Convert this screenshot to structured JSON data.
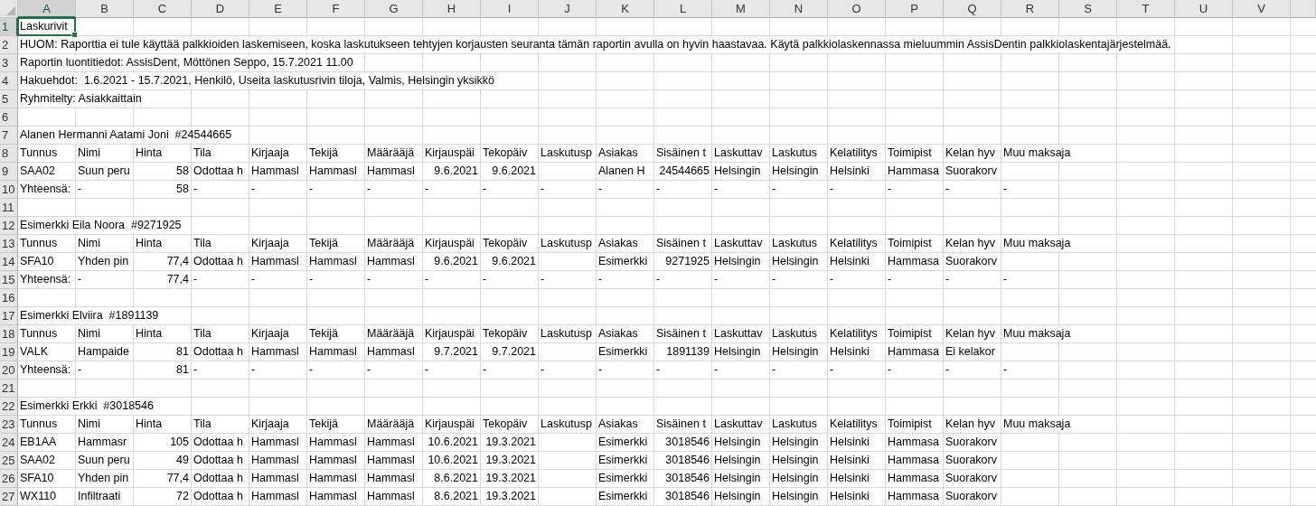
{
  "columns": [
    {
      "label": "A",
      "selected": true
    },
    {
      "label": "B",
      "selected": false
    },
    {
      "label": "C",
      "selected": false
    },
    {
      "label": "D",
      "selected": false
    },
    {
      "label": "E",
      "selected": false
    },
    {
      "label": "F",
      "selected": false
    },
    {
      "label": "G",
      "selected": false
    },
    {
      "label": "H",
      "selected": false
    },
    {
      "label": "I",
      "selected": false
    },
    {
      "label": "J",
      "selected": false
    },
    {
      "label": "K",
      "selected": false
    },
    {
      "label": "L",
      "selected": false
    },
    {
      "label": "M",
      "selected": false
    },
    {
      "label": "N",
      "selected": false
    },
    {
      "label": "O",
      "selected": false
    },
    {
      "label": "P",
      "selected": false
    },
    {
      "label": "Q",
      "selected": false
    },
    {
      "label": "R",
      "selected": false
    },
    {
      "label": "S",
      "selected": false
    },
    {
      "label": "T",
      "selected": false
    },
    {
      "label": "U",
      "selected": false
    },
    {
      "label": "V",
      "selected": false
    }
  ],
  "rows": [
    {
      "number": "1",
      "selected": true,
      "cells": [
        {
          "kind": "text",
          "text": "Laskurivit"
        }
      ]
    },
    {
      "number": "2",
      "selected": false,
      "cells": [
        {
          "kind": "text",
          "text": "HUOM: Raporttia ei tule käyttää palkkioiden laskemiseen, koska laskutukseen tehtyjen korjausten seuranta tämän raportin avulla on hyvin haastavaa. Käytä palkkiolaskennassa mieluummin AssisDentin palkkiolaskentajärjestelmää."
        }
      ]
    },
    {
      "number": "3",
      "selected": false,
      "cells": [
        {
          "kind": "text",
          "text": "Raportin luontitiedot: AssisDent, Möttönen Seppo, 15.7.2021 11.00"
        }
      ]
    },
    {
      "number": "4",
      "selected": false,
      "cells": [
        {
          "kind": "text",
          "text": "Hakuehdot:  1.6.2021 - 15.7.2021, Henkilö, Useita laskutusrivin tiloja, Valmis, Helsingin yksikkö"
        }
      ]
    },
    {
      "number": "5",
      "selected": false,
      "cells": [
        {
          "kind": "text",
          "text": "Ryhmitelty: Asiakkaittain"
        }
      ]
    },
    {
      "number": "6",
      "selected": false,
      "cells": []
    },
    {
      "number": "7",
      "selected": false,
      "cells": [
        {
          "kind": "text",
          "text": "Alanen Hermanni Aatami Joni  #24544665"
        }
      ]
    },
    {
      "number": "8",
      "selected": false,
      "cells": [
        {
          "kind": "text",
          "text": "Tunnus"
        },
        {
          "kind": "text",
          "text": "Nimi"
        },
        {
          "kind": "text",
          "text": "Hinta"
        },
        {
          "kind": "text",
          "text": "Tila"
        },
        {
          "kind": "text",
          "text": "Kirjaaja"
        },
        {
          "kind": "text",
          "text": "Tekijä"
        },
        {
          "kind": "text",
          "text": "Määrääjä"
        },
        {
          "kind": "text",
          "text": "Kirjauspäi"
        },
        {
          "kind": "text",
          "text": "Tekopäiv"
        },
        {
          "kind": "text",
          "text": "Laskutusp"
        },
        {
          "kind": "text",
          "text": "Asiakas"
        },
        {
          "kind": "text",
          "text": "Sisäinen t"
        },
        {
          "kind": "text",
          "text": "Laskuttav"
        },
        {
          "kind": "text",
          "text": "Laskutus"
        },
        {
          "kind": "text",
          "text": "Kelatilitys"
        },
        {
          "kind": "text",
          "text": "Toimipist"
        },
        {
          "kind": "text",
          "text": "Kelan hyv"
        },
        {
          "kind": "text",
          "text": "Muu maksaja"
        }
      ]
    },
    {
      "number": "9",
      "selected": false,
      "cells": [
        {
          "kind": "text",
          "text": "SAA02"
        },
        {
          "kind": "text",
          "text": "Suun peru"
        },
        {
          "kind": "number",
          "text": "58"
        },
        {
          "kind": "text",
          "text": "Odottaa h"
        },
        {
          "kind": "text",
          "text": "Hammasl"
        },
        {
          "kind": "text",
          "text": "Hammasl"
        },
        {
          "kind": "text",
          "text": "Hammasl"
        },
        {
          "kind": "number",
          "text": "9.6.2021"
        },
        {
          "kind": "number",
          "text": "9.6.2021"
        },
        null,
        {
          "kind": "text",
          "text": "Alanen H"
        },
        {
          "kind": "number",
          "text": "24544665"
        },
        {
          "kind": "text",
          "text": "Helsingin"
        },
        {
          "kind": "text",
          "text": "Helsingin"
        },
        {
          "kind": "text",
          "text": "Helsinki"
        },
        {
          "kind": "text",
          "text": "Hammasa"
        },
        {
          "kind": "text",
          "text": "Suorakorv"
        }
      ]
    },
    {
      "number": "10",
      "selected": false,
      "cells": [
        {
          "kind": "text",
          "text": "Yhteensä:"
        },
        {
          "kind": "text",
          "text": "-"
        },
        {
          "kind": "number",
          "text": "58"
        },
        {
          "kind": "text",
          "text": "-"
        },
        {
          "kind": "text",
          "text": "-"
        },
        {
          "kind": "text",
          "text": "-"
        },
        {
          "kind": "text",
          "text": "-"
        },
        {
          "kind": "text",
          "text": "-"
        },
        {
          "kind": "text",
          "text": "-"
        },
        {
          "kind": "text",
          "text": "-"
        },
        {
          "kind": "text",
          "text": "-"
        },
        {
          "kind": "text",
          "text": "-"
        },
        {
          "kind": "text",
          "text": "-"
        },
        {
          "kind": "text",
          "text": "-"
        },
        {
          "kind": "text",
          "text": "-"
        },
        {
          "kind": "text",
          "text": "-"
        },
        {
          "kind": "text",
          "text": "-"
        },
        {
          "kind": "text",
          "text": "-"
        }
      ]
    },
    {
      "number": "11",
      "selected": false,
      "cells": []
    },
    {
      "number": "12",
      "selected": false,
      "cells": [
        {
          "kind": "text",
          "text": "Esimerkki Eila Noora  #9271925"
        }
      ]
    },
    {
      "number": "13",
      "selected": false,
      "cells": [
        {
          "kind": "text",
          "text": "Tunnus"
        },
        {
          "kind": "text",
          "text": "Nimi"
        },
        {
          "kind": "text",
          "text": "Hinta"
        },
        {
          "kind": "text",
          "text": "Tila"
        },
        {
          "kind": "text",
          "text": "Kirjaaja"
        },
        {
          "kind": "text",
          "text": "Tekijä"
        },
        {
          "kind": "text",
          "text": "Määrääjä"
        },
        {
          "kind": "text",
          "text": "Kirjauspäi"
        },
        {
          "kind": "text",
          "text": "Tekopäiv"
        },
        {
          "kind": "text",
          "text": "Laskutusp"
        },
        {
          "kind": "text",
          "text": "Asiakas"
        },
        {
          "kind": "text",
          "text": "Sisäinen t"
        },
        {
          "kind": "text",
          "text": "Laskuttav"
        },
        {
          "kind": "text",
          "text": "Laskutus"
        },
        {
          "kind": "text",
          "text": "Kelatilitys"
        },
        {
          "kind": "text",
          "text": "Toimipist"
        },
        {
          "kind": "text",
          "text": "Kelan hyv"
        },
        {
          "kind": "text",
          "text": "Muu maksaja"
        }
      ]
    },
    {
      "number": "14",
      "selected": false,
      "cells": [
        {
          "kind": "text",
          "text": "SFA10"
        },
        {
          "kind": "text",
          "text": "Yhden pin"
        },
        {
          "kind": "number",
          "text": "77,4"
        },
        {
          "kind": "text",
          "text": "Odottaa h"
        },
        {
          "kind": "text",
          "text": "Hammasl"
        },
        {
          "kind": "text",
          "text": "Hammasl"
        },
        {
          "kind": "text",
          "text": "Hammasl"
        },
        {
          "kind": "number",
          "text": "9.6.2021"
        },
        {
          "kind": "number",
          "text": "9.6.2021"
        },
        null,
        {
          "kind": "text",
          "text": "Esimerkki"
        },
        {
          "kind": "number",
          "text": "9271925"
        },
        {
          "kind": "text",
          "text": "Helsingin"
        },
        {
          "kind": "text",
          "text": "Helsingin"
        },
        {
          "kind": "text",
          "text": "Helsinki"
        },
        {
          "kind": "text",
          "text": "Hammasa"
        },
        {
          "kind": "text",
          "text": "Suorakorv"
        }
      ]
    },
    {
      "number": "15",
      "selected": false,
      "cells": [
        {
          "kind": "text",
          "text": "Yhteensä:"
        },
        {
          "kind": "text",
          "text": "-"
        },
        {
          "kind": "number",
          "text": "77,4"
        },
        {
          "kind": "text",
          "text": "-"
        },
        {
          "kind": "text",
          "text": "-"
        },
        {
          "kind": "text",
          "text": "-"
        },
        {
          "kind": "text",
          "text": "-"
        },
        {
          "kind": "text",
          "text": "-"
        },
        {
          "kind": "text",
          "text": "-"
        },
        {
          "kind": "text",
          "text": "-"
        },
        {
          "kind": "text",
          "text": "-"
        },
        {
          "kind": "text",
          "text": "-"
        },
        {
          "kind": "text",
          "text": "-"
        },
        {
          "kind": "text",
          "text": "-"
        },
        {
          "kind": "text",
          "text": "-"
        },
        {
          "kind": "text",
          "text": "-"
        },
        {
          "kind": "text",
          "text": "-"
        },
        {
          "kind": "text",
          "text": "-"
        }
      ]
    },
    {
      "number": "16",
      "selected": false,
      "cells": []
    },
    {
      "number": "17",
      "selected": false,
      "cells": [
        {
          "kind": "text",
          "text": "Esimerkki Elviira  #1891139"
        }
      ]
    },
    {
      "number": "18",
      "selected": false,
      "cells": [
        {
          "kind": "text",
          "text": "Tunnus"
        },
        {
          "kind": "text",
          "text": "Nimi"
        },
        {
          "kind": "text",
          "text": "Hinta"
        },
        {
          "kind": "text",
          "text": "Tila"
        },
        {
          "kind": "text",
          "text": "Kirjaaja"
        },
        {
          "kind": "text",
          "text": "Tekijä"
        },
        {
          "kind": "text",
          "text": "Määrääjä"
        },
        {
          "kind": "text",
          "text": "Kirjauspäi"
        },
        {
          "kind": "text",
          "text": "Tekopäiv"
        },
        {
          "kind": "text",
          "text": "Laskutusp"
        },
        {
          "kind": "text",
          "text": "Asiakas"
        },
        {
          "kind": "text",
          "text": "Sisäinen t"
        },
        {
          "kind": "text",
          "text": "Laskuttav"
        },
        {
          "kind": "text",
          "text": "Laskutus"
        },
        {
          "kind": "text",
          "text": "Kelatilitys"
        },
        {
          "kind": "text",
          "text": "Toimipist"
        },
        {
          "kind": "text",
          "text": "Kelan hyv"
        },
        {
          "kind": "text",
          "text": "Muu maksaja"
        }
      ]
    },
    {
      "number": "19",
      "selected": false,
      "cells": [
        {
          "kind": "text",
          "text": "VALK"
        },
        {
          "kind": "text",
          "text": "Hampaide"
        },
        {
          "kind": "number",
          "text": "81"
        },
        {
          "kind": "text",
          "text": "Odottaa h"
        },
        {
          "kind": "text",
          "text": "Hammasl"
        },
        {
          "kind": "text",
          "text": "Hammasl"
        },
        {
          "kind": "text",
          "text": "Hammasl"
        },
        {
          "kind": "number",
          "text": "9.7.2021"
        },
        {
          "kind": "number",
          "text": "9.7.2021"
        },
        null,
        {
          "kind": "text",
          "text": "Esimerkki"
        },
        {
          "kind": "number",
          "text": "1891139"
        },
        {
          "kind": "text",
          "text": "Helsingin"
        },
        {
          "kind": "text",
          "text": "Helsingin"
        },
        {
          "kind": "text",
          "text": "Helsinki"
        },
        {
          "kind": "text",
          "text": "Hammasa"
        },
        {
          "kind": "text",
          "text": "Ei kelakor"
        }
      ]
    },
    {
      "number": "20",
      "selected": false,
      "cells": [
        {
          "kind": "text",
          "text": "Yhteensä:"
        },
        {
          "kind": "text",
          "text": "-"
        },
        {
          "kind": "number",
          "text": "81"
        },
        {
          "kind": "text",
          "text": "-"
        },
        {
          "kind": "text",
          "text": "-"
        },
        {
          "kind": "text",
          "text": "-"
        },
        {
          "kind": "text",
          "text": "-"
        },
        {
          "kind": "text",
          "text": "-"
        },
        {
          "kind": "text",
          "text": "-"
        },
        {
          "kind": "text",
          "text": "-"
        },
        {
          "kind": "text",
          "text": "-"
        },
        {
          "kind": "text",
          "text": "-"
        },
        {
          "kind": "text",
          "text": "-"
        },
        {
          "kind": "text",
          "text": "-"
        },
        {
          "kind": "text",
          "text": "-"
        },
        {
          "kind": "text",
          "text": "-"
        },
        {
          "kind": "text",
          "text": "-"
        },
        {
          "kind": "text",
          "text": "-"
        }
      ]
    },
    {
      "number": "21",
      "selected": false,
      "cells": []
    },
    {
      "number": "22",
      "selected": false,
      "cells": [
        {
          "kind": "text",
          "text": "Esimerkki Erkki  #3018546"
        }
      ]
    },
    {
      "number": "23",
      "selected": false,
      "cells": [
        {
          "kind": "text",
          "text": "Tunnus"
        },
        {
          "kind": "text",
          "text": "Nimi"
        },
        {
          "kind": "text",
          "text": "Hinta"
        },
        {
          "kind": "text",
          "text": "Tila"
        },
        {
          "kind": "text",
          "text": "Kirjaaja"
        },
        {
          "kind": "text",
          "text": "Tekijä"
        },
        {
          "kind": "text",
          "text": "Määrääjä"
        },
        {
          "kind": "text",
          "text": "Kirjauspäi"
        },
        {
          "kind": "text",
          "text": "Tekopäiv"
        },
        {
          "kind": "text",
          "text": "Laskutusp"
        },
        {
          "kind": "text",
          "text": "Asiakas"
        },
        {
          "kind": "text",
          "text": "Sisäinen t"
        },
        {
          "kind": "text",
          "text": "Laskuttav"
        },
        {
          "kind": "text",
          "text": "Laskutus"
        },
        {
          "kind": "text",
          "text": "Kelatilitys"
        },
        {
          "kind": "text",
          "text": "Toimipist"
        },
        {
          "kind": "text",
          "text": "Kelan hyv"
        },
        {
          "kind": "text",
          "text": "Muu maksaja"
        }
      ]
    },
    {
      "number": "24",
      "selected": false,
      "cells": [
        {
          "kind": "text",
          "text": "EB1AA"
        },
        {
          "kind": "text",
          "text": "Hammasr"
        },
        {
          "kind": "number",
          "text": "105"
        },
        {
          "kind": "text",
          "text": "Odottaa h"
        },
        {
          "kind": "text",
          "text": "Hammasl"
        },
        {
          "kind": "text",
          "text": "Hammasl"
        },
        {
          "kind": "text",
          "text": "Hammasl"
        },
        {
          "kind": "number",
          "text": "10.6.2021"
        },
        {
          "kind": "number",
          "text": "19.3.2021"
        },
        null,
        {
          "kind": "text",
          "text": "Esimerkki"
        },
        {
          "kind": "number",
          "text": "3018546"
        },
        {
          "kind": "text",
          "text": "Helsingin"
        },
        {
          "kind": "text",
          "text": "Helsingin"
        },
        {
          "kind": "text",
          "text": "Helsinki"
        },
        {
          "kind": "text",
          "text": "Hammasa"
        },
        {
          "kind": "text",
          "text": "Suorakorv"
        }
      ]
    },
    {
      "number": "25",
      "selected": false,
      "cells": [
        {
          "kind": "text",
          "text": "SAA02"
        },
        {
          "kind": "text",
          "text": "Suun peru"
        },
        {
          "kind": "number",
          "text": "49"
        },
        {
          "kind": "text",
          "text": "Odottaa h"
        },
        {
          "kind": "text",
          "text": "Hammasl"
        },
        {
          "kind": "text",
          "text": "Hammasl"
        },
        {
          "kind": "text",
          "text": "Hammasl"
        },
        {
          "kind": "number",
          "text": "10.6.2021"
        },
        {
          "kind": "number",
          "text": "19.3.2021"
        },
        null,
        {
          "kind": "text",
          "text": "Esimerkki"
        },
        {
          "kind": "number",
          "text": "3018546"
        },
        {
          "kind": "text",
          "text": "Helsingin"
        },
        {
          "kind": "text",
          "text": "Helsingin"
        },
        {
          "kind": "text",
          "text": "Helsinki"
        },
        {
          "kind": "text",
          "text": "Hammasa"
        },
        {
          "kind": "text",
          "text": "Suorakorv"
        }
      ]
    },
    {
      "number": "26",
      "selected": false,
      "cells": [
        {
          "kind": "text",
          "text": "SFA10"
        },
        {
          "kind": "text",
          "text": "Yhden pin"
        },
        {
          "kind": "number",
          "text": "77,4"
        },
        {
          "kind": "text",
          "text": "Odottaa h"
        },
        {
          "kind": "text",
          "text": "Hammasl"
        },
        {
          "kind": "text",
          "text": "Hammasl"
        },
        {
          "kind": "text",
          "text": "Hammasl"
        },
        {
          "kind": "number",
          "text": "8.6.2021"
        },
        {
          "kind": "number",
          "text": "19.3.2021"
        },
        null,
        {
          "kind": "text",
          "text": "Esimerkki"
        },
        {
          "kind": "number",
          "text": "3018546"
        },
        {
          "kind": "text",
          "text": "Helsingin"
        },
        {
          "kind": "text",
          "text": "Helsingin"
        },
        {
          "kind": "text",
          "text": "Helsinki"
        },
        {
          "kind": "text",
          "text": "Hammasa"
        },
        {
          "kind": "text",
          "text": "Suorakorv"
        }
      ]
    },
    {
      "number": "27",
      "selected": false,
      "cells": [
        {
          "kind": "text",
          "text": "WX110"
        },
        {
          "kind": "text",
          "text": "Infiltraati"
        },
        {
          "kind": "number",
          "text": "72"
        },
        {
          "kind": "text",
          "text": "Odottaa h"
        },
        {
          "kind": "text",
          "text": "Hammasl"
        },
        {
          "kind": "text",
          "text": "Hammasl"
        },
        {
          "kind": "text",
          "text": "Hammasl"
        },
        {
          "kind": "number",
          "text": "8.6.2021"
        },
        {
          "kind": "number",
          "text": "19.3.2021"
        },
        null,
        {
          "kind": "text",
          "text": "Esimerkki"
        },
        {
          "kind": "number",
          "text": "3018546"
        },
        {
          "kind": "text",
          "text": "Helsingin"
        },
        {
          "kind": "text",
          "text": "Helsingin"
        },
        {
          "kind": "text",
          "text": "Helsinki"
        },
        {
          "kind": "text",
          "text": "Hammasa"
        },
        {
          "kind": "text",
          "text": "Suorakorv"
        }
      ]
    }
  ]
}
